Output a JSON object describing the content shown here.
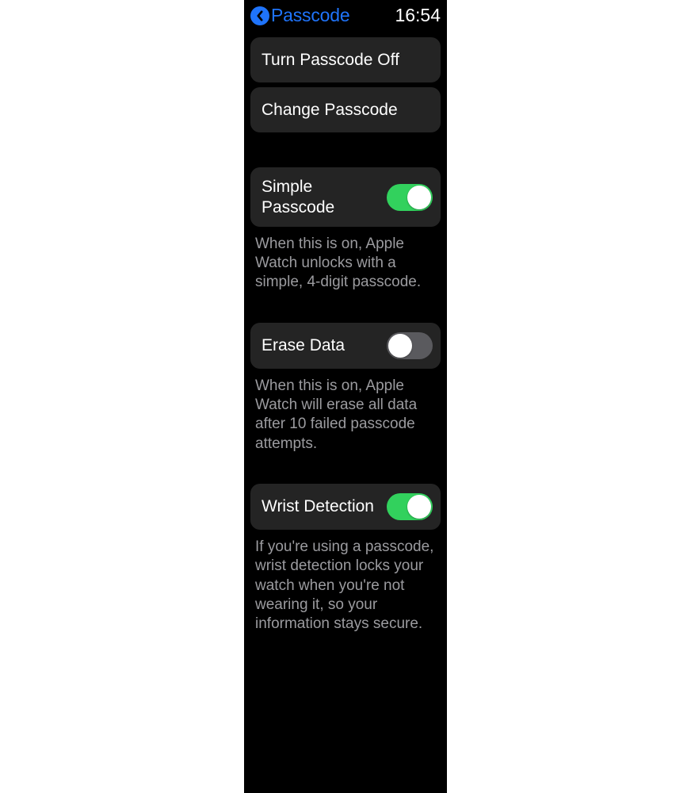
{
  "header": {
    "title": "Passcode",
    "time": "16:54"
  },
  "buttons": {
    "turn_off": "Turn Passcode Off",
    "change": "Change Passcode"
  },
  "settings": {
    "simple_passcode": {
      "label": "Simple Passcode",
      "state": "on",
      "description": "When this is on, Apple Watch unlocks with a simple, 4-digit passcode."
    },
    "erase_data": {
      "label": "Erase Data",
      "state": "off",
      "description": "When this is on, Apple Watch will erase all data after 10 failed passcode attempts."
    },
    "wrist_detection": {
      "label": "Wrist Detection",
      "state": "on",
      "description": "If you're using a passcode, wrist detection locks your watch when you're not wearing it, so your information stays secure."
    }
  }
}
